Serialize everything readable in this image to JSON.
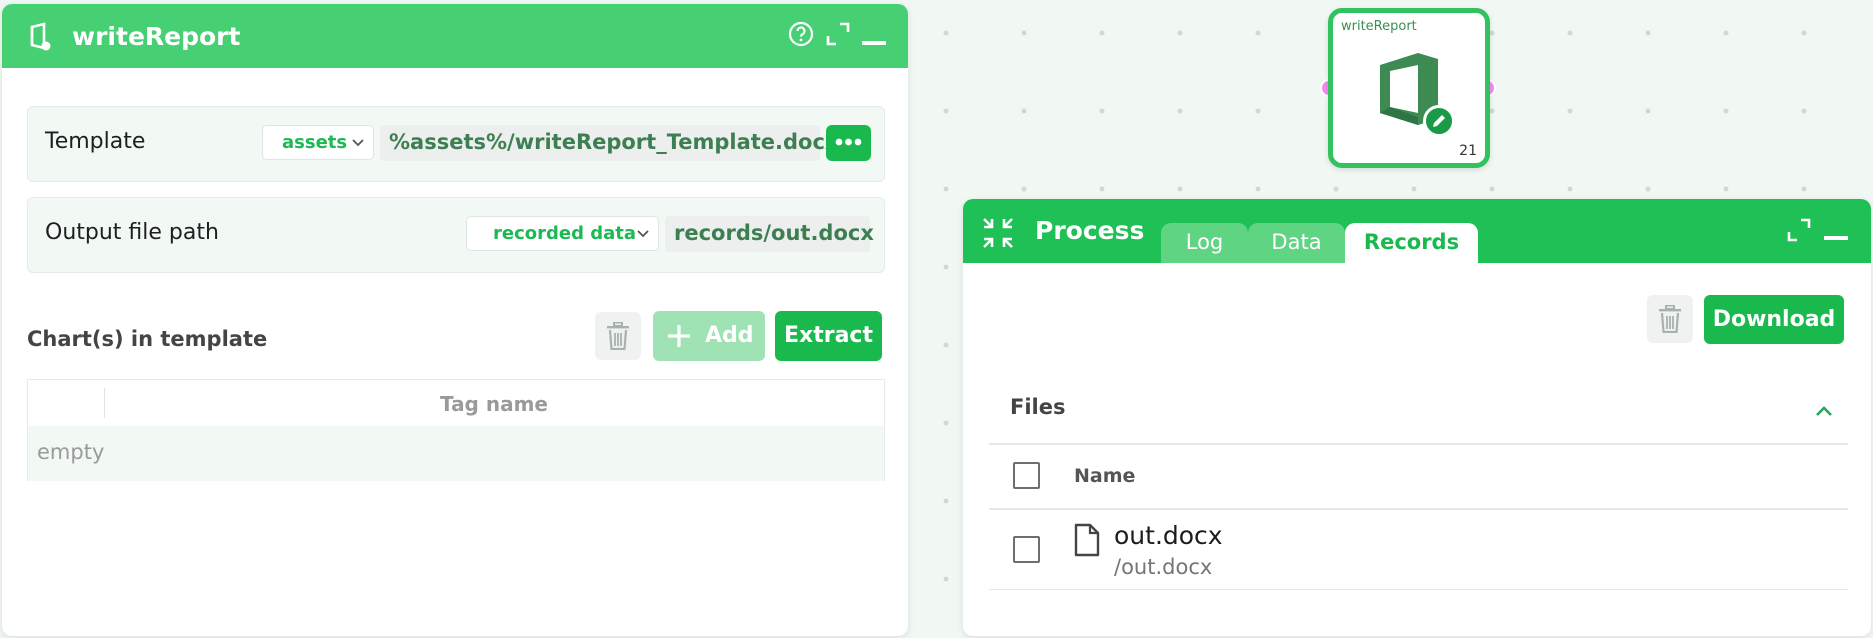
{
  "colors": {
    "header_green": "#47cf73",
    "primary_green": "#19b94e",
    "process_header": "#1fc056",
    "port_pink": "#f58cf2"
  },
  "left_panel": {
    "title": "writeReport",
    "icons": [
      "office-icon",
      "help-icon",
      "expand-icon",
      "minimize-icon"
    ],
    "template_row": {
      "label": "Template",
      "source_select": "assets",
      "path": "%assets%/writeReport_Template.docx"
    },
    "output_row": {
      "label": "Output file path",
      "source_select": "recorded data",
      "path": "records/out.docx"
    },
    "charts": {
      "title": "Chart(s) in template",
      "add_label": "Add",
      "extract_label": "Extract",
      "table_header": "Tag name",
      "empty_text": "empty"
    }
  },
  "node": {
    "title": "writeReport",
    "badge": "21"
  },
  "right_panel": {
    "title": "Process",
    "tabs": [
      {
        "label": "Log",
        "active": false
      },
      {
        "label": "Data",
        "active": false
      },
      {
        "label": "Records",
        "active": true
      }
    ],
    "download_label": "Download",
    "files": {
      "title": "Files",
      "column_name": "Name",
      "items": [
        {
          "name": "out.docx",
          "path": "/out.docx"
        }
      ]
    }
  }
}
